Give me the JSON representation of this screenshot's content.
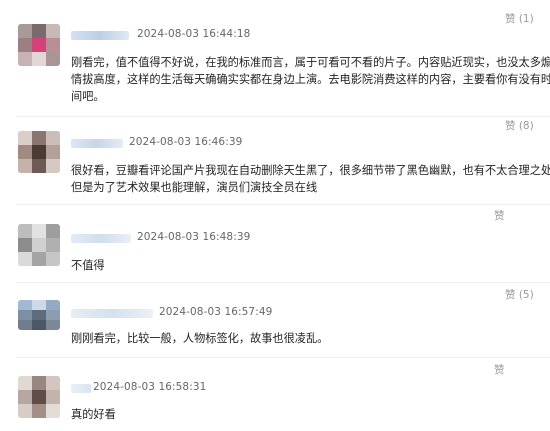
{
  "comments": [
    {
      "timestamp": "2024-08-03 16:44:18",
      "like_label": "赞 (1)",
      "lines": [
        "刚看完，值不值得不好说，在我的标准而言，属于可看可不看的片子。内容贴近现实，也没太多煽",
        "情拔高度，这样的生活每天确确实实都在身边上演。去电影院消费这样的内容，主要看你有没有时",
        "间吧。"
      ]
    },
    {
      "timestamp": "2024-08-03 16:46:39",
      "like_label": "赞 (8)",
      "lines": [
        "很好看，豆瓣看评论国产片我现在自动删除天生黑了，很多细节带了黑色幽默，也有不太合理之处",
        "但是为了艺术效果也能理解，演员们演技全员在线"
      ]
    },
    {
      "timestamp": "2024-08-03 16:48:39",
      "like_label": "赞",
      "lines": [
        "不值得"
      ]
    },
    {
      "timestamp": "2024-08-03 16:57:49",
      "like_label": "赞 (5)",
      "lines": [
        "刚刚看完，比较一般，人物标签化，故事也很凌乱。"
      ]
    },
    {
      "timestamp": "2024-08-03 16:58:31",
      "like_label": "赞",
      "lines": [
        "真的好看"
      ]
    }
  ],
  "colors": {
    "text": "#222222",
    "timestamp": "#666666",
    "like": "#999999",
    "divider": "#eeeeee"
  }
}
